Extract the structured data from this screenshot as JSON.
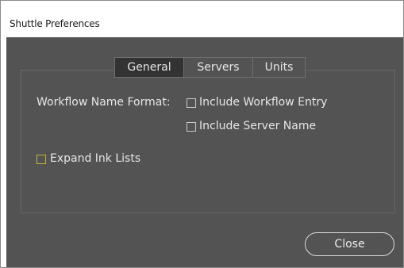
{
  "window": {
    "title": "Shuttle Preferences"
  },
  "tabs": [
    {
      "label": "General",
      "active": true
    },
    {
      "label": "Servers",
      "active": false
    },
    {
      "label": "Units",
      "active": false
    }
  ],
  "general": {
    "workflow_name_format_label": "Workflow Name Format:",
    "include_workflow_entry": {
      "label": "Include Workflow Entry",
      "checked": false
    },
    "include_server_name": {
      "label": "Include Server Name",
      "checked": false
    },
    "expand_ink_lists": {
      "label": "Expand Ink Lists",
      "checked": false
    }
  },
  "buttons": {
    "close_label": "Close"
  },
  "colors": {
    "panel_background": "#535353",
    "active_tab": "#333333",
    "checkbox_focus_accent": "#c8b23a"
  }
}
